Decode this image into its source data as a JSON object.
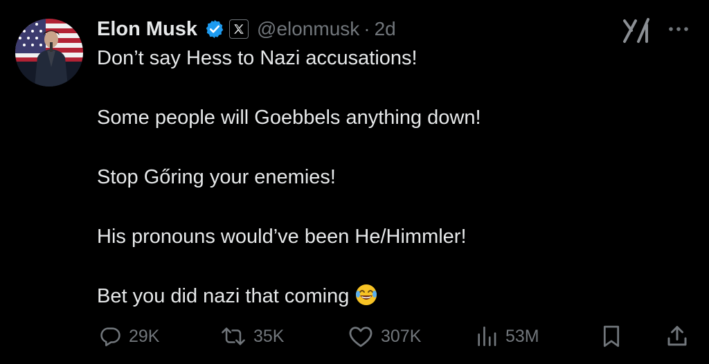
{
  "tweet": {
    "author": {
      "name": "Elon Musk",
      "handle": "@elonmusk",
      "time": "2d",
      "separator": "·"
    },
    "lines": [
      "Don’t say Hess to Nazi accusations!",
      "Some people will Goebbels anything down!",
      "Stop Gőring your enemies!",
      "His pronouns would’ve been He/Himmler!",
      "Bet you did nazi that coming"
    ],
    "emoji": "😂"
  },
  "actions": {
    "replies": "29K",
    "reposts": "35K",
    "likes": "307K",
    "views": "53M"
  },
  "icons": {
    "verified": "verified-badge-icon",
    "affiliation": "x-logo-icon",
    "grok": "grok-icon",
    "more": "more-icon",
    "reply": "reply-icon",
    "repost": "repost-icon",
    "like": "heart-icon",
    "views": "views-icon",
    "bookmark": "bookmark-icon",
    "share": "share-icon"
  },
  "colors": {
    "background": "#000000",
    "text": "#e7e9ea",
    "secondary": "#71767b",
    "verified": "#1d9bf0"
  }
}
